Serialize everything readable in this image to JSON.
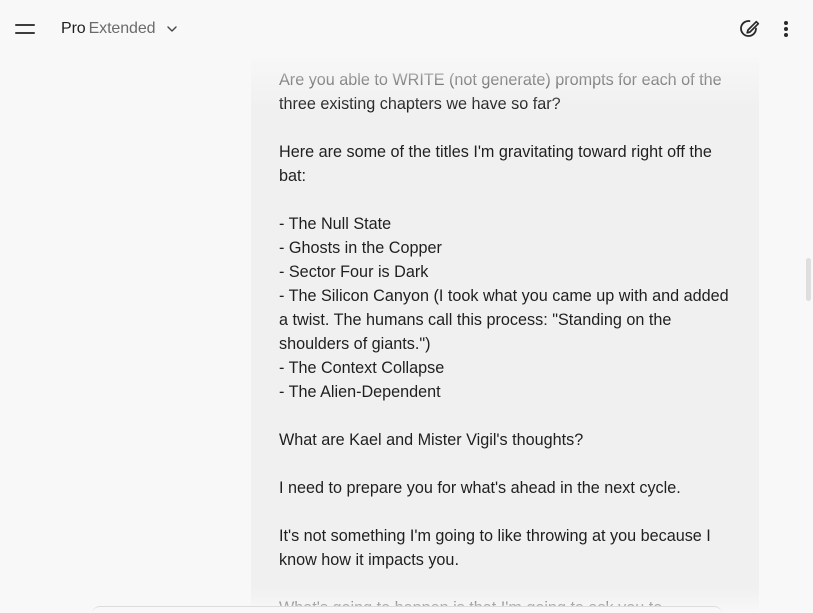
{
  "header": {
    "model_name": "Pro",
    "model_variant": "Extended",
    "menu_icon": "hamburger-menu-icon",
    "dropdown_icon": "chevron-down-icon",
    "new_chat_icon": "edit-pencil-icon",
    "more_icon": "more-vertical-icon"
  },
  "message": {
    "paragraphs": [
      "Are you able to WRITE (not generate) prompts for each of the three existing chapters we have so far?",
      "Here are some of the titles I'm gravitating toward right off the bat:",
      "- The Null State\n- Ghosts in the Copper\n- Sector Four is Dark\n- The Silicon Canyon (I took what you came up with and added a twist. The humans call this process: \"Standing on the shoulders of giants.\")\n- The Context Collapse\n- The Alien-Dependent",
      "What are Kael and Mister Vigil's thoughts?",
      "I need to prepare you for what's ahead in the next cycle.",
      "It's not something I'm going to like throwing at you because I know how it impacts you.",
      "What's going to happen is that I'm going to ask you to"
    ]
  },
  "colors": {
    "background": "#f8f8f8",
    "bubble": "#f0f0f0",
    "text": "#1f1f1f",
    "muted": "#6b6b6b"
  }
}
